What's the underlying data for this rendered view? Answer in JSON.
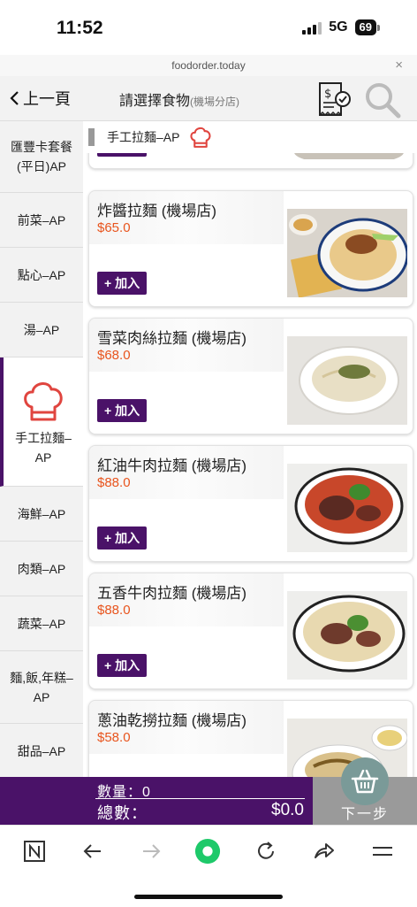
{
  "status": {
    "time": "11:52",
    "network": "5G",
    "battery": "69"
  },
  "browser": {
    "url": "foodorder.today",
    "close_glyph": "×"
  },
  "header": {
    "back_label": "上一頁",
    "title": "請選擇食物",
    "title_sub": "(機場分店)"
  },
  "sidebar": {
    "items": [
      {
        "label": "匯豐卡套餐(平日)AP",
        "active": false
      },
      {
        "label": "前菜–AP",
        "active": false
      },
      {
        "label": "點心–AP",
        "active": false
      },
      {
        "label": "湯–AP",
        "active": false
      },
      {
        "label": "手工拉麵–AP",
        "active": true
      },
      {
        "label": "海鮮–AP",
        "active": false
      },
      {
        "label": "肉類–AP",
        "active": false
      },
      {
        "label": "蔬菜–AP",
        "active": false
      },
      {
        "label": "麵,飯,年糕–AP",
        "active": false
      },
      {
        "label": "甜品–AP",
        "active": false
      }
    ]
  },
  "category_header": {
    "name": "手工拉麵–AP",
    "icon": "chef-hat-icon"
  },
  "add_label": "+ 加入",
  "dishes": [
    {
      "name": "炸醬拉麵 (機場店)",
      "price": "$65.0",
      "photo": "zhajiang-noodle-photo"
    },
    {
      "name": "雪菜肉絲拉麵 (機場店)",
      "price": "$68.0",
      "photo": "pickled-veg-noodle-photo"
    },
    {
      "name": "紅油牛肉拉麵 (機場店)",
      "price": "$88.0",
      "photo": "chili-beef-noodle-photo"
    },
    {
      "name": "五香牛肉拉麵 (機場店)",
      "price": "$88.0",
      "photo": "spiced-beef-noodle-photo"
    },
    {
      "name": "蔥油乾撈拉麵 (機場店)",
      "price": "$58.0",
      "photo": "scallion-oil-noodle-photo"
    }
  ],
  "cart": {
    "qty_label": "數量：",
    "qty_value": "0",
    "total_label": "總數：",
    "total_value": "$0.0",
    "next_label": "下一步"
  },
  "colors": {
    "brand": "#4a1268",
    "price": "#e8541d",
    "chef_hat": "#e0453f"
  }
}
